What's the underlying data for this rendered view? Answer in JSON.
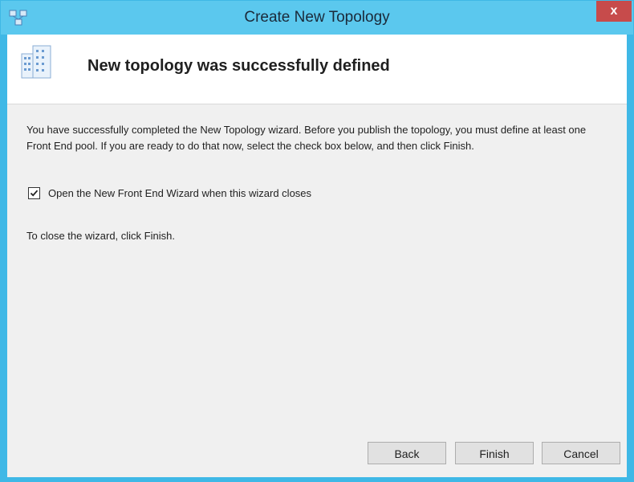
{
  "window": {
    "title": "Create New Topology",
    "close_glyph": "x",
    "icon": "topology-app-icon"
  },
  "header": {
    "title": "New topology was successfully defined",
    "icon": "building-icon"
  },
  "content": {
    "description": "You have successfully completed the New Topology wizard. Before you publish the topology, you must define at least one Front End pool. If you are ready to do that now, select the check box below, and then click Finish.",
    "checkbox_label": "Open the New Front End Wizard when this wizard closes",
    "checkbox_checked": true,
    "close_hint": "To close the wizard, click Finish."
  },
  "buttons": {
    "back": "Back",
    "finish": "Finish",
    "cancel": "Cancel"
  },
  "colors": {
    "titlebar": "#5bc8ee",
    "close": "#c74b4b",
    "content_bg": "#f0f0f0"
  }
}
